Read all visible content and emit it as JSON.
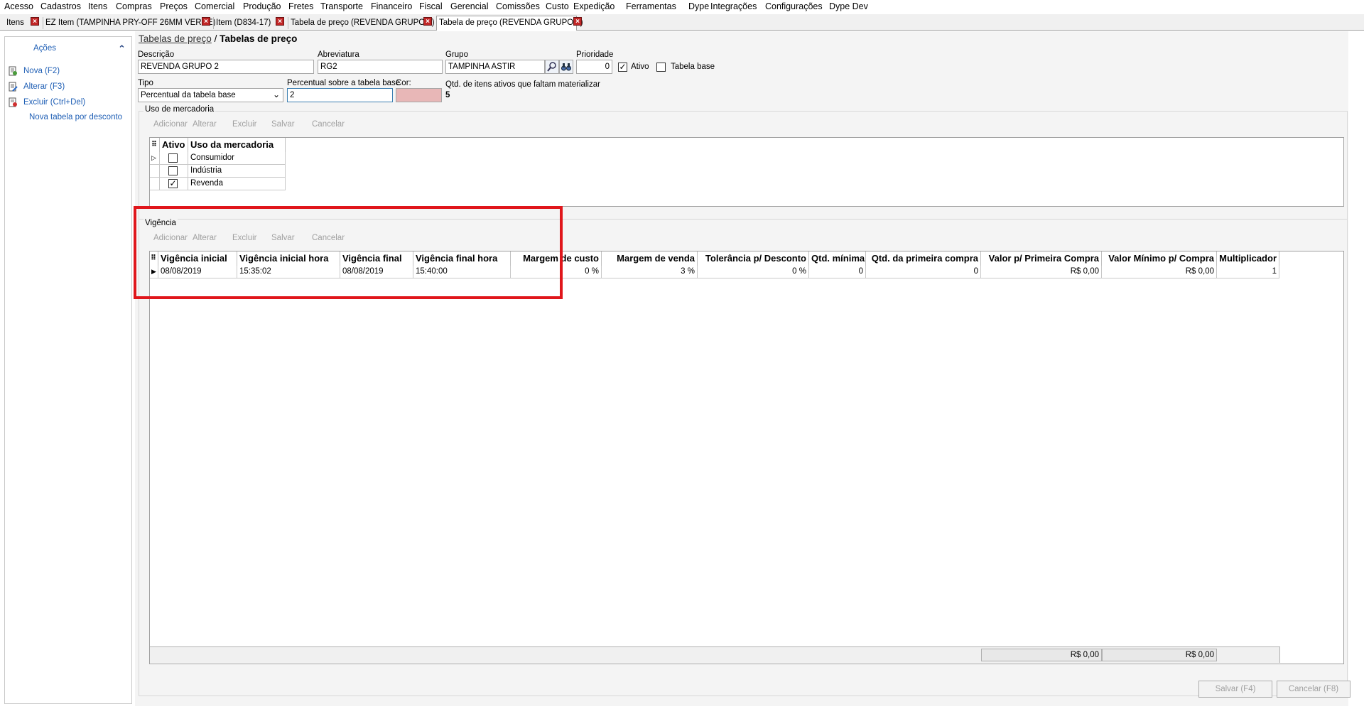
{
  "menu": [
    "Acesso",
    "Cadastros",
    "Itens",
    "Compras",
    "Preços",
    "Comercial",
    "Produção",
    "Fretes",
    "Transporte",
    "Financeiro",
    "Fiscal",
    "Gerencial",
    "Comissões",
    "Custo",
    "Expedição",
    "Ferramentas",
    "Dype",
    "Integrações",
    "Configurações",
    "Dype Dev"
  ],
  "tabs": [
    {
      "label": "Itens"
    },
    {
      "label": "EZ Item (TAMPINHA PRY-OFF 26MM VERDE)"
    },
    {
      "label": "Item (D834-17)"
    },
    {
      "label": "Tabela de preço (REVENDA GRUPO 1)"
    },
    {
      "label": "Tabela de preço (REVENDA GRUPO 2)"
    }
  ],
  "tab_close_glyph": "×",
  "sidebar": {
    "title": "Ações",
    "collapse_glyph": "⌃",
    "items": [
      {
        "label": "Nova (F2)",
        "icon": "new-document-icon"
      },
      {
        "label": "Alterar (F3)",
        "icon": "edit-document-icon"
      },
      {
        "label": "Excluir (Ctrl+Del)",
        "icon": "delete-document-icon"
      },
      {
        "label": "Nova tabela por desconto",
        "icon": ""
      }
    ]
  },
  "breadcrumb": {
    "link": "Tabelas de preço",
    "separator": "/",
    "current": "Tabelas de preço"
  },
  "form": {
    "descricao_label": "Descrição",
    "descricao": "REVENDA GRUPO 2",
    "abreviatura_label": "Abreviatura",
    "abreviatura": "RG2",
    "grupo_label": "Grupo",
    "grupo": "TAMPINHA ASTIR",
    "prioridade_label": "Prioridade",
    "prioridade": "0",
    "ativo_label": "Ativo",
    "ativo_checked": "✓",
    "tabela_base_label": "Tabela base",
    "tipo_label": "Tipo",
    "tipo": "Percentual da tabela base",
    "tipo_arrow": "⌄",
    "percentual_label": "Percentual sobre a tabela base",
    "percentual": "2",
    "cor_label": "Cor:",
    "cor_value": "#e8b7b7",
    "qtd_label": "Qtd. de itens ativos que faltam materializar",
    "qtd_value": "5"
  },
  "uso": {
    "title": "Uso de mercadoria",
    "toolbar": [
      "Adicionar",
      "Alterar",
      "Excluir",
      "Salvar",
      "Cancelar"
    ],
    "grid_glyph": "⠿",
    "headers": [
      "Ativo",
      "Uso da mercadoria"
    ],
    "rows": [
      {
        "ativo": "",
        "uso": "Consumidor",
        "indicator": "▷"
      },
      {
        "ativo": "",
        "uso": "Indústria",
        "indicator": ""
      },
      {
        "ativo": "✓",
        "uso": "Revenda",
        "indicator": ""
      }
    ]
  },
  "vigencia": {
    "title": "Vigência",
    "toolbar": [
      "Adicionar",
      "Alterar",
      "Excluir",
      "Salvar",
      "Cancelar"
    ],
    "grid_glyph": "⠿",
    "headers": [
      "Vigência inicial",
      "Vigência inicial hora",
      "Vigência final",
      "Vigência final hora",
      "Margem de custo",
      "Margem de venda",
      "Tolerância p/ Desconto",
      "Qtd. mínima",
      "Qtd. da primeira compra",
      "Valor p/ Primeira Compra",
      "Valor Mínimo p/ Compra",
      "Multiplicador"
    ],
    "rows": [
      {
        "indicator": "▶",
        "cells": [
          "08/08/2019",
          "15:35:02",
          "08/08/2019",
          "15:40:00",
          "0 %",
          "3 %",
          "0 %",
          "0",
          "0",
          "R$ 0,00",
          "R$ 0,00",
          "1"
        ]
      }
    ],
    "footer": [
      "R$ 0,00",
      "R$ 0,00"
    ]
  },
  "highlight_color": "#e0161b",
  "buttons": {
    "salvar": "Salvar (F4)",
    "cancelar": "Cancelar (F8)"
  }
}
